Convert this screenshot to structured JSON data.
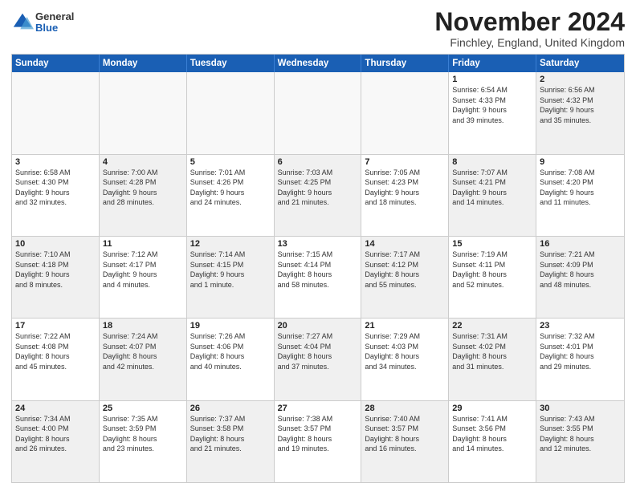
{
  "logo": {
    "general": "General",
    "blue": "Blue"
  },
  "title": "November 2024",
  "location": "Finchley, England, United Kingdom",
  "days_of_week": [
    "Sunday",
    "Monday",
    "Tuesday",
    "Wednesday",
    "Thursday",
    "Friday",
    "Saturday"
  ],
  "weeks": [
    [
      {
        "day": "",
        "info": "",
        "shaded": true,
        "empty": true
      },
      {
        "day": "",
        "info": "",
        "shaded": true,
        "empty": true
      },
      {
        "day": "",
        "info": "",
        "shaded": true,
        "empty": true
      },
      {
        "day": "",
        "info": "",
        "shaded": true,
        "empty": true
      },
      {
        "day": "",
        "info": "",
        "shaded": true,
        "empty": true
      },
      {
        "day": "1",
        "info": "Sunrise: 6:54 AM\nSunset: 4:33 PM\nDaylight: 9 hours\nand 39 minutes.",
        "shaded": false
      },
      {
        "day": "2",
        "info": "Sunrise: 6:56 AM\nSunset: 4:32 PM\nDaylight: 9 hours\nand 35 minutes.",
        "shaded": true
      }
    ],
    [
      {
        "day": "3",
        "info": "Sunrise: 6:58 AM\nSunset: 4:30 PM\nDaylight: 9 hours\nand 32 minutes.",
        "shaded": false
      },
      {
        "day": "4",
        "info": "Sunrise: 7:00 AM\nSunset: 4:28 PM\nDaylight: 9 hours\nand 28 minutes.",
        "shaded": true
      },
      {
        "day": "5",
        "info": "Sunrise: 7:01 AM\nSunset: 4:26 PM\nDaylight: 9 hours\nand 24 minutes.",
        "shaded": false
      },
      {
        "day": "6",
        "info": "Sunrise: 7:03 AM\nSunset: 4:25 PM\nDaylight: 9 hours\nand 21 minutes.",
        "shaded": true
      },
      {
        "day": "7",
        "info": "Sunrise: 7:05 AM\nSunset: 4:23 PM\nDaylight: 9 hours\nand 18 minutes.",
        "shaded": false
      },
      {
        "day": "8",
        "info": "Sunrise: 7:07 AM\nSunset: 4:21 PM\nDaylight: 9 hours\nand 14 minutes.",
        "shaded": true
      },
      {
        "day": "9",
        "info": "Sunrise: 7:08 AM\nSunset: 4:20 PM\nDaylight: 9 hours\nand 11 minutes.",
        "shaded": false
      }
    ],
    [
      {
        "day": "10",
        "info": "Sunrise: 7:10 AM\nSunset: 4:18 PM\nDaylight: 9 hours\nand 8 minutes.",
        "shaded": true
      },
      {
        "day": "11",
        "info": "Sunrise: 7:12 AM\nSunset: 4:17 PM\nDaylight: 9 hours\nand 4 minutes.",
        "shaded": false
      },
      {
        "day": "12",
        "info": "Sunrise: 7:14 AM\nSunset: 4:15 PM\nDaylight: 9 hours\nand 1 minute.",
        "shaded": true
      },
      {
        "day": "13",
        "info": "Sunrise: 7:15 AM\nSunset: 4:14 PM\nDaylight: 8 hours\nand 58 minutes.",
        "shaded": false
      },
      {
        "day": "14",
        "info": "Sunrise: 7:17 AM\nSunset: 4:12 PM\nDaylight: 8 hours\nand 55 minutes.",
        "shaded": true
      },
      {
        "day": "15",
        "info": "Sunrise: 7:19 AM\nSunset: 4:11 PM\nDaylight: 8 hours\nand 52 minutes.",
        "shaded": false
      },
      {
        "day": "16",
        "info": "Sunrise: 7:21 AM\nSunset: 4:09 PM\nDaylight: 8 hours\nand 48 minutes.",
        "shaded": true
      }
    ],
    [
      {
        "day": "17",
        "info": "Sunrise: 7:22 AM\nSunset: 4:08 PM\nDaylight: 8 hours\nand 45 minutes.",
        "shaded": false
      },
      {
        "day": "18",
        "info": "Sunrise: 7:24 AM\nSunset: 4:07 PM\nDaylight: 8 hours\nand 42 minutes.",
        "shaded": true
      },
      {
        "day": "19",
        "info": "Sunrise: 7:26 AM\nSunset: 4:06 PM\nDaylight: 8 hours\nand 40 minutes.",
        "shaded": false
      },
      {
        "day": "20",
        "info": "Sunrise: 7:27 AM\nSunset: 4:04 PM\nDaylight: 8 hours\nand 37 minutes.",
        "shaded": true
      },
      {
        "day": "21",
        "info": "Sunrise: 7:29 AM\nSunset: 4:03 PM\nDaylight: 8 hours\nand 34 minutes.",
        "shaded": false
      },
      {
        "day": "22",
        "info": "Sunrise: 7:31 AM\nSunset: 4:02 PM\nDaylight: 8 hours\nand 31 minutes.",
        "shaded": true
      },
      {
        "day": "23",
        "info": "Sunrise: 7:32 AM\nSunset: 4:01 PM\nDaylight: 8 hours\nand 29 minutes.",
        "shaded": false
      }
    ],
    [
      {
        "day": "24",
        "info": "Sunrise: 7:34 AM\nSunset: 4:00 PM\nDaylight: 8 hours\nand 26 minutes.",
        "shaded": true
      },
      {
        "day": "25",
        "info": "Sunrise: 7:35 AM\nSunset: 3:59 PM\nDaylight: 8 hours\nand 23 minutes.",
        "shaded": false
      },
      {
        "day": "26",
        "info": "Sunrise: 7:37 AM\nSunset: 3:58 PM\nDaylight: 8 hours\nand 21 minutes.",
        "shaded": true
      },
      {
        "day": "27",
        "info": "Sunrise: 7:38 AM\nSunset: 3:57 PM\nDaylight: 8 hours\nand 19 minutes.",
        "shaded": false
      },
      {
        "day": "28",
        "info": "Sunrise: 7:40 AM\nSunset: 3:57 PM\nDaylight: 8 hours\nand 16 minutes.",
        "shaded": true
      },
      {
        "day": "29",
        "info": "Sunrise: 7:41 AM\nSunset: 3:56 PM\nDaylight: 8 hours\nand 14 minutes.",
        "shaded": false
      },
      {
        "day": "30",
        "info": "Sunrise: 7:43 AM\nSunset: 3:55 PM\nDaylight: 8 hours\nand 12 minutes.",
        "shaded": true
      }
    ]
  ]
}
